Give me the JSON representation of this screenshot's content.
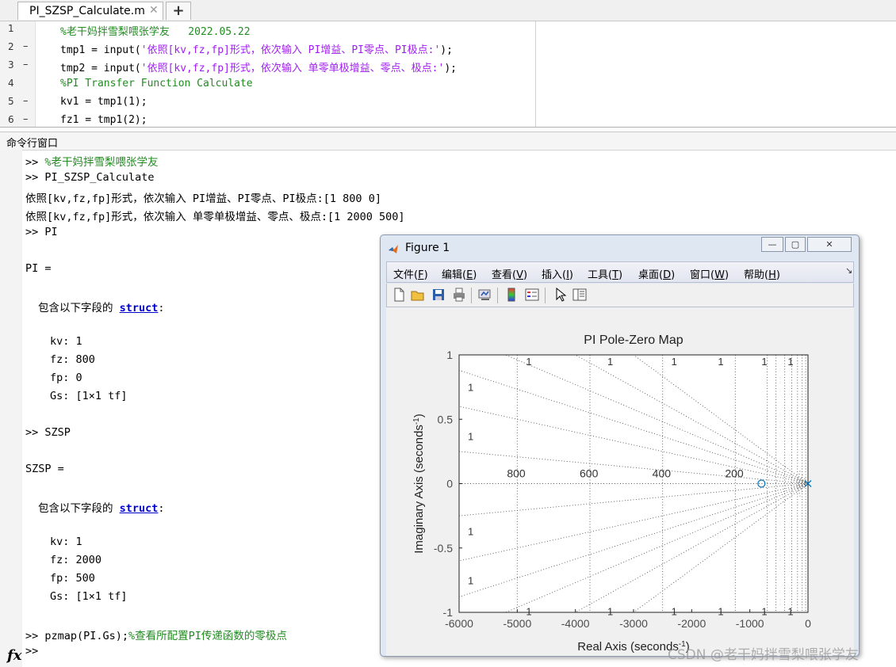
{
  "editor": {
    "tab_label": "PI_SZSP_Calculate.m",
    "tab_close": "✕",
    "add_tab": "+",
    "lines": [
      {
        "num": "1",
        "dash": "",
        "segments": [
          {
            "t": "%老干妈拌雪梨喂张学友   2022.05.22",
            "c": "green"
          }
        ]
      },
      {
        "num": "2",
        "dash": "–",
        "segments": [
          {
            "t": "tmp1 = input(",
            "c": "black"
          },
          {
            "t": "'依照[kv,fz,fp]形式，依次输入 PI增益、PI零点、PI极点:'",
            "c": "purple"
          },
          {
            "t": ");",
            "c": "black"
          }
        ]
      },
      {
        "num": "3",
        "dash": "–",
        "segments": [
          {
            "t": "tmp2 = input(",
            "c": "black"
          },
          {
            "t": "'依照[kv,fz,fp]形式，依次输入 单零单极增益、零点、极点:'",
            "c": "purple"
          },
          {
            "t": ");",
            "c": "black"
          }
        ]
      },
      {
        "num": "4",
        "dash": "",
        "segments": [
          {
            "t": "%PI Transfer Function Calculate",
            "c": "green"
          }
        ]
      },
      {
        "num": "5",
        "dash": "–",
        "segments": [
          {
            "t": "kv1 = tmp1(1);",
            "c": "black"
          }
        ]
      },
      {
        "num": "6",
        "dash": "–",
        "segments": [
          {
            "t": "fz1 = tmp1(2);",
            "c": "black"
          }
        ]
      }
    ]
  },
  "command_window": {
    "header": "命令行窗口",
    "fx": "fx",
    "lines": [
      {
        "indent": 0,
        "segments": [
          {
            "t": ">> ",
            "c": "black"
          },
          {
            "t": "%老干妈拌雪梨喂张学友",
            "c": "green"
          }
        ]
      },
      {
        "indent": 0,
        "segments": [
          {
            "t": ">> PI_SZSP_Calculate",
            "c": "black"
          }
        ]
      },
      {
        "indent": 0,
        "segments": [
          {
            "t": "依照[kv,fz,fp]形式，依次输入 PI增益、PI零点、PI极点:[1 800 0]",
            "c": "black"
          }
        ]
      },
      {
        "indent": 0,
        "segments": [
          {
            "t": "依照[kv,fz,fp]形式，依次输入 单零单极增益、零点、极点:[1 2000 500]",
            "c": "black"
          }
        ]
      },
      {
        "indent": 0,
        "segments": [
          {
            "t": ">> PI",
            "c": "black"
          }
        ]
      },
      {
        "indent": 0,
        "segments": []
      },
      {
        "indent": 0,
        "segments": [
          {
            "t": "PI =",
            "c": "black"
          }
        ]
      },
      {
        "indent": 0,
        "segments": []
      },
      {
        "indent": 1,
        "segments": [
          {
            "t": "包含以下字段的 ",
            "c": "black"
          },
          {
            "t": "struct",
            "c": "link"
          },
          {
            "t": ":",
            "c": "black"
          }
        ]
      },
      {
        "indent": 0,
        "segments": []
      },
      {
        "indent": 2,
        "segments": [
          {
            "t": "kv: 1",
            "c": "black"
          }
        ]
      },
      {
        "indent": 2,
        "segments": [
          {
            "t": "fz: 800",
            "c": "black"
          }
        ]
      },
      {
        "indent": 2,
        "segments": [
          {
            "t": "fp: 0",
            "c": "black"
          }
        ]
      },
      {
        "indent": 2,
        "segments": [
          {
            "t": "Gs: [1×1 tf]",
            "c": "black"
          }
        ]
      },
      {
        "indent": 0,
        "segments": []
      },
      {
        "indent": 0,
        "segments": [
          {
            "t": ">> SZSP",
            "c": "black"
          }
        ]
      },
      {
        "indent": 0,
        "segments": []
      },
      {
        "indent": 0,
        "segments": [
          {
            "t": "SZSP =",
            "c": "black"
          }
        ]
      },
      {
        "indent": 0,
        "segments": []
      },
      {
        "indent": 1,
        "segments": [
          {
            "t": "包含以下字段的 ",
            "c": "black"
          },
          {
            "t": "struct",
            "c": "link"
          },
          {
            "t": ":",
            "c": "black"
          }
        ]
      },
      {
        "indent": 0,
        "segments": []
      },
      {
        "indent": 2,
        "segments": [
          {
            "t": "kv: 1",
            "c": "black"
          }
        ]
      },
      {
        "indent": 2,
        "segments": [
          {
            "t": "fz: 2000",
            "c": "black"
          }
        ]
      },
      {
        "indent": 2,
        "segments": [
          {
            "t": "fp: 500",
            "c": "black"
          }
        ]
      },
      {
        "indent": 2,
        "segments": [
          {
            "t": "Gs: [1×1 tf]",
            "c": "black"
          }
        ]
      },
      {
        "indent": 0,
        "segments": []
      },
      {
        "indent": 0,
        "segments": [
          {
            "t": ">> pzmap(PI.Gs);",
            "c": "black"
          },
          {
            "t": "%查看所配置PI传递函数的零极点",
            "c": "green"
          }
        ]
      },
      {
        "indent": 0,
        "segments": [
          {
            "t": ">>",
            "c": "black"
          }
        ]
      }
    ]
  },
  "figure": {
    "title": "Figure 1",
    "window_buttons": {
      "minimize": "—",
      "restore": "▢",
      "close": "✕"
    },
    "menus": [
      {
        "label": "文件(",
        "key": "F",
        "tail": ")"
      },
      {
        "label": "编辑(",
        "key": "E",
        "tail": ")"
      },
      {
        "label": "查看(",
        "key": "V",
        "tail": ")"
      },
      {
        "label": "插入(",
        "key": "I",
        "tail": ")"
      },
      {
        "label": "工具(",
        "key": "T",
        "tail": ")"
      },
      {
        "label": "桌面(",
        "key": "D",
        "tail": ")"
      },
      {
        "label": "窗口(",
        "key": "W",
        "tail": ")"
      },
      {
        "label": "帮助(",
        "key": "H",
        "tail": ")"
      }
    ],
    "menu_more": "↘",
    "toolbar_icons": [
      "new-figure-icon",
      "open-file-icon",
      "save-icon",
      "print-icon",
      "link-plot-icon",
      "insert-colorbar-icon",
      "insert-legend-icon",
      "edit-plot-icon",
      "property-inspector-icon"
    ]
  },
  "chart_data": {
    "type": "scatter",
    "title": "PI Pole-Zero Map",
    "xlabel": "Real Axis (seconds",
    "xlabel_sup": "-1",
    "xlabel_tail": ")",
    "ylabel": "Imaginary Axis (seconds",
    "ylabel_sup": "-1",
    "ylabel_tail": ")",
    "xlim": [
      -6000,
      0
    ],
    "ylim": [
      -1,
      1
    ],
    "xticks": [
      -6000,
      -5000,
      -4000,
      -3000,
      -2000,
      -1000,
      0
    ],
    "yticks": [
      -1,
      -0.5,
      0,
      0.5,
      1
    ],
    "series": [
      {
        "marker": "o",
        "color": "#0072BD",
        "x": [
          -800
        ],
        "y": [
          0
        ]
      },
      {
        "marker": "x",
        "color": "#0072BD",
        "x": [
          0
        ],
        "y": [
          0
        ]
      }
    ],
    "grid": {
      "frequency_labels": [
        "800",
        "600",
        "400",
        "200"
      ],
      "frequency_values": [
        800,
        600,
        400,
        200
      ],
      "damping_label": "1"
    },
    "grid_on": true
  },
  "watermark": "CSDN @老干妈拌雪梨喂张学友"
}
